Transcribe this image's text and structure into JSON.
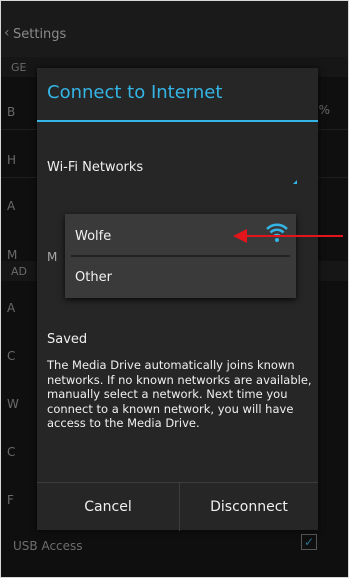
{
  "background": {
    "back_glyph": "‹",
    "title": "Settings",
    "rows": [
      "GE",
      "B",
      "H",
      "A",
      "M",
      "AD",
      "A",
      "C",
      "W",
      "C",
      "F"
    ],
    "percent_glyph": "%",
    "usb_label": "USB Access",
    "usb_checked": true
  },
  "dialog": {
    "title": "Connect to Internet",
    "wifi_label": "Wi-Fi Networks",
    "networks": [
      {
        "name": "Wolfe",
        "icon": "wifi-signal-icon"
      },
      {
        "name": "Other"
      }
    ],
    "saved_label": "Saved",
    "description": "The Media Drive automatically joins known networks. If no known networks are available, manually select a network. Next time you connect to a known network, you will have access to the Media Drive.",
    "buttons": {
      "cancel": "Cancel",
      "disconnect": "Disconnect"
    }
  },
  "colors": {
    "accent": "#33b5e5",
    "annotation_arrow": "#e2141c",
    "dialog_bg": "#262626"
  }
}
